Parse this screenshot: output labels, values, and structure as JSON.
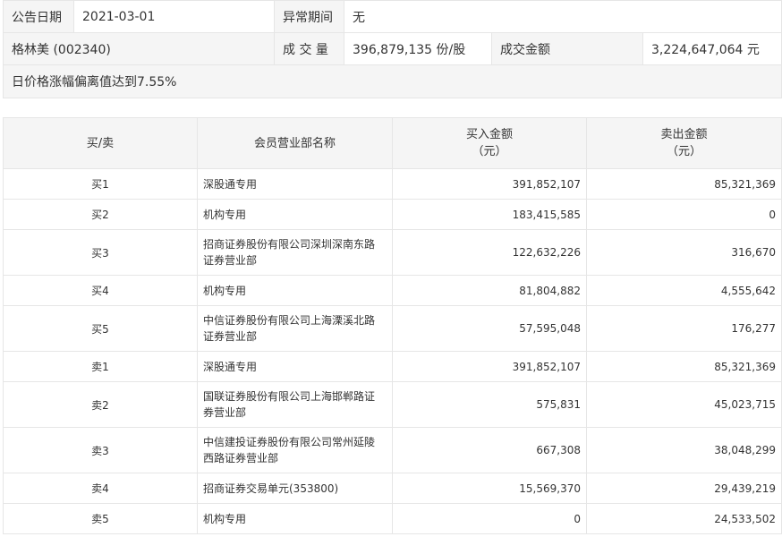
{
  "summary": {
    "date_label": "公告日期",
    "date_value": "2021-03-01",
    "period_label": "异常期间",
    "period_value": "无",
    "stock_name": "格林美 (002340)",
    "volume_label": "成 交 量",
    "volume_value": "396,879,135 份/股",
    "amount_label": "成交金额",
    "amount_value": "3,224,647,064 元",
    "reason": "日价格涨幅偏离值达到7.55%"
  },
  "table": {
    "headers": {
      "direction": "买/卖",
      "department": "会员营业部名称",
      "buy_line1": "买入金额",
      "buy_line2": "（元）",
      "sell_line1": "卖出金额",
      "sell_line2": "（元）"
    },
    "rows": [
      {
        "dir": "买1",
        "name": "深股通专用",
        "buy": "391,852,107",
        "sell": "85,321,369"
      },
      {
        "dir": "买2",
        "name": "机构专用",
        "buy": "183,415,585",
        "sell": "0"
      },
      {
        "dir": "买3",
        "name": "招商证券股份有限公司深圳深南东路证券营业部",
        "buy": "122,632,226",
        "sell": "316,670"
      },
      {
        "dir": "买4",
        "name": "机构专用",
        "buy": "81,804,882",
        "sell": "4,555,642"
      },
      {
        "dir": "买5",
        "name": "中信证券股份有限公司上海溧溪北路证券营业部",
        "buy": "57,595,048",
        "sell": "176,277"
      },
      {
        "dir": "卖1",
        "name": "深股通专用",
        "buy": "391,852,107",
        "sell": "85,321,369"
      },
      {
        "dir": "卖2",
        "name": "国联证券股份有限公司上海邯郸路证券营业部",
        "buy": "575,831",
        "sell": "45,023,715"
      },
      {
        "dir": "卖3",
        "name": "中信建投证券股份有限公司常州延陵西路证券营业部",
        "buy": "667,308",
        "sell": "38,048,299"
      },
      {
        "dir": "卖4",
        "name": "招商证券交易单元(353800)",
        "buy": "15,569,370",
        "sell": "29,439,219"
      },
      {
        "dir": "卖5",
        "name": "机构专用",
        "buy": "0",
        "sell": "24,533,502"
      }
    ]
  }
}
